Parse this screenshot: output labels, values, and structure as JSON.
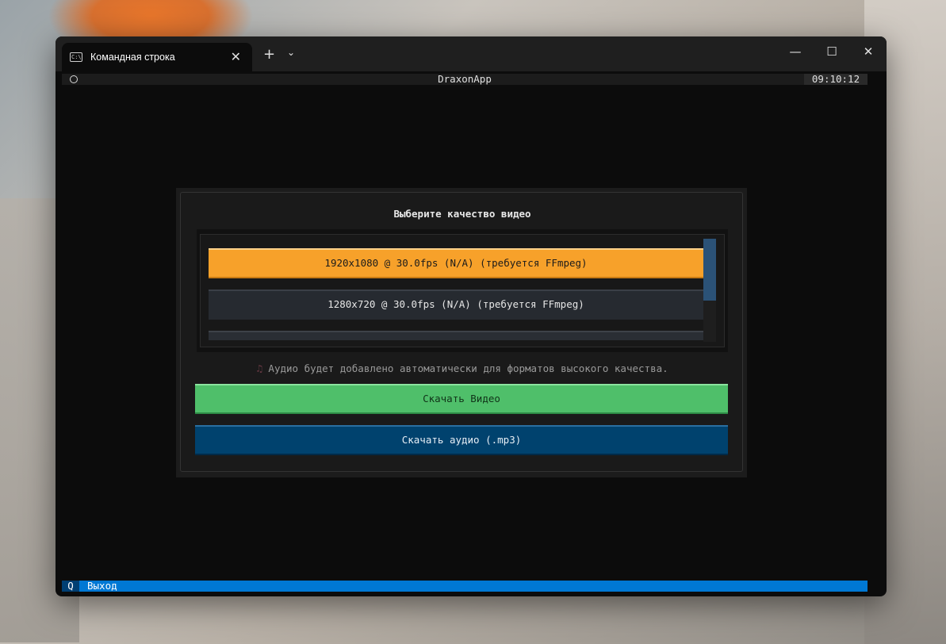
{
  "window": {
    "tab_title": "Командная строка",
    "tab_icon": "terminal-icon",
    "close_tab_glyph": "✕",
    "new_tab_glyph": "+",
    "dropdown_glyph": "⌄",
    "minimize_glyph": "—",
    "maximize_glyph": "☐",
    "close_glyph": "✕"
  },
  "header": {
    "title": "DraxonApp",
    "clock": "09:10:12"
  },
  "dialog": {
    "title": "Выберите качество видео",
    "options": [
      "1920x1080 @ 30.0fps (N/A) (требуется FFmpeg)",
      "1280x720 @ 30.0fps (N/A) (требуется FFmpeg)"
    ],
    "info_icon": "♫",
    "info_text": "Аудио будет добавлено автоматически для форматов высокого качества.",
    "download_video_label": "Скачать Видео",
    "download_audio_label": "Скачать аудио (.mp3)"
  },
  "footer": {
    "key": "Q",
    "label": "Выход"
  },
  "colors": {
    "selected_option": "#f7a12a",
    "video_button": "#4fbf6a",
    "audio_button": "#00426e",
    "footer_bar": "#0078d4"
  }
}
